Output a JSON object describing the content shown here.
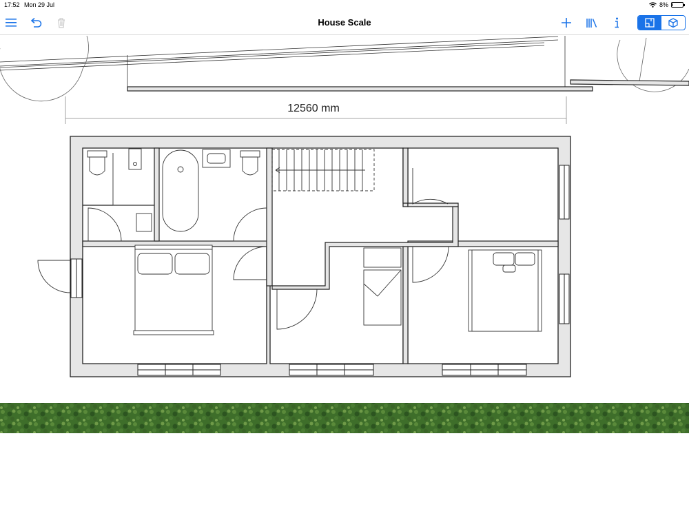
{
  "status": {
    "time": "17:52",
    "date": "Mon 29 Jul",
    "battery": "8%",
    "battery_level": 0.08
  },
  "toolbar": {
    "title": "House Scale"
  },
  "icons": {
    "menu": "hamburger-menu-icon",
    "undo": "undo-icon",
    "trash": "trash-icon",
    "add": "plus-icon",
    "library": "library-books-icon",
    "info": "info-icon",
    "plan_view": "plan-view-icon",
    "view_3d": "3d-cube-icon"
  },
  "colors": {
    "accent": "#1a73e8",
    "wall_fill": "#e6e6e6",
    "wall_stroke": "#222222",
    "hedge": "#3e6e2a"
  },
  "drawing": {
    "dimension_label": "12560 mm"
  }
}
